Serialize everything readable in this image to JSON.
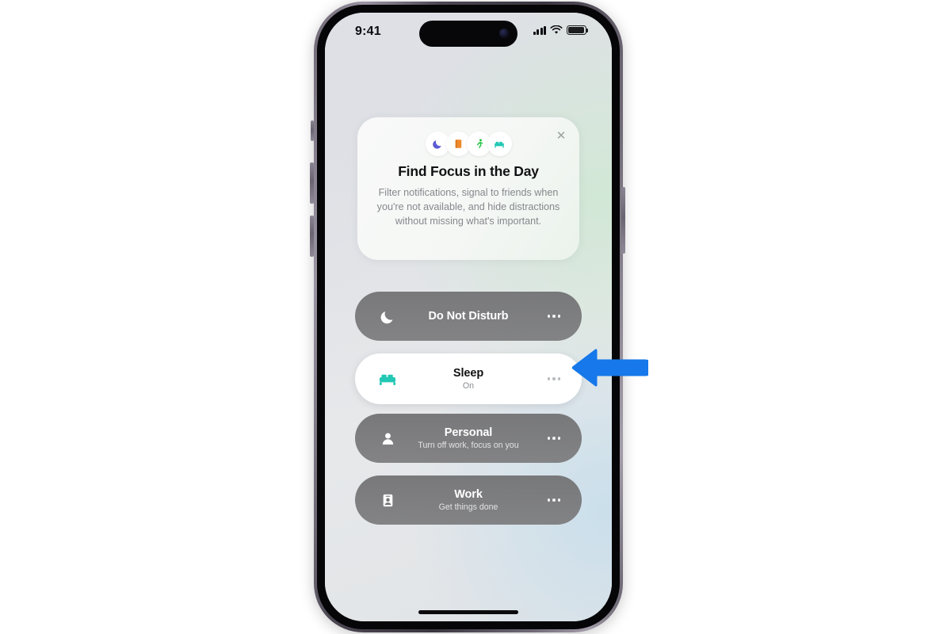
{
  "device": {
    "status_bar": {
      "time": "9:41",
      "cellular_icon": "cellular-signal-icon",
      "wifi_icon": "wifi-icon",
      "battery_icon": "battery-icon"
    },
    "home_indicator": "home-indicator"
  },
  "promo_card": {
    "title": "Find Focus in the Day",
    "body": "Filter notifications, signal to friends when you're not available, and hide distractions without missing what's important.",
    "close_icon": "✕",
    "icons": [
      {
        "name": "crescent-moon-icon",
        "glyph": "🌙"
      },
      {
        "name": "book-icon",
        "glyph": "📙"
      },
      {
        "name": "running-person-icon",
        "glyph": "🏃"
      },
      {
        "name": "bed-icon",
        "glyph": "🛏"
      }
    ]
  },
  "focus_modes": [
    {
      "id": "do-not-disturb",
      "title": "Do Not Disturb",
      "subtitle": "",
      "state": "inactive",
      "icon": "crescent-moon-icon",
      "more_label": "..."
    },
    {
      "id": "sleep",
      "title": "Sleep",
      "subtitle": "On",
      "state": "active",
      "icon": "bed-icon",
      "more_label": "..."
    },
    {
      "id": "personal",
      "title": "Personal",
      "subtitle": "Turn off work, focus on you",
      "state": "inactive",
      "icon": "person-icon",
      "more_label": "..."
    },
    {
      "id": "work",
      "title": "Work",
      "subtitle": "Get things done",
      "state": "inactive",
      "icon": "id-badge-icon",
      "more_label": "..."
    }
  ],
  "annotation": {
    "arrow_direction": "left",
    "arrow_color": "#1678ea",
    "points_at": "sleep"
  },
  "colors": {
    "accent_blue": "#1678ea",
    "active_row_bg": "#ffffff",
    "inactive_row_bg": "#757577",
    "sleep_icon_teal": "#22c8b4",
    "card_bg": "#f8faf8"
  }
}
